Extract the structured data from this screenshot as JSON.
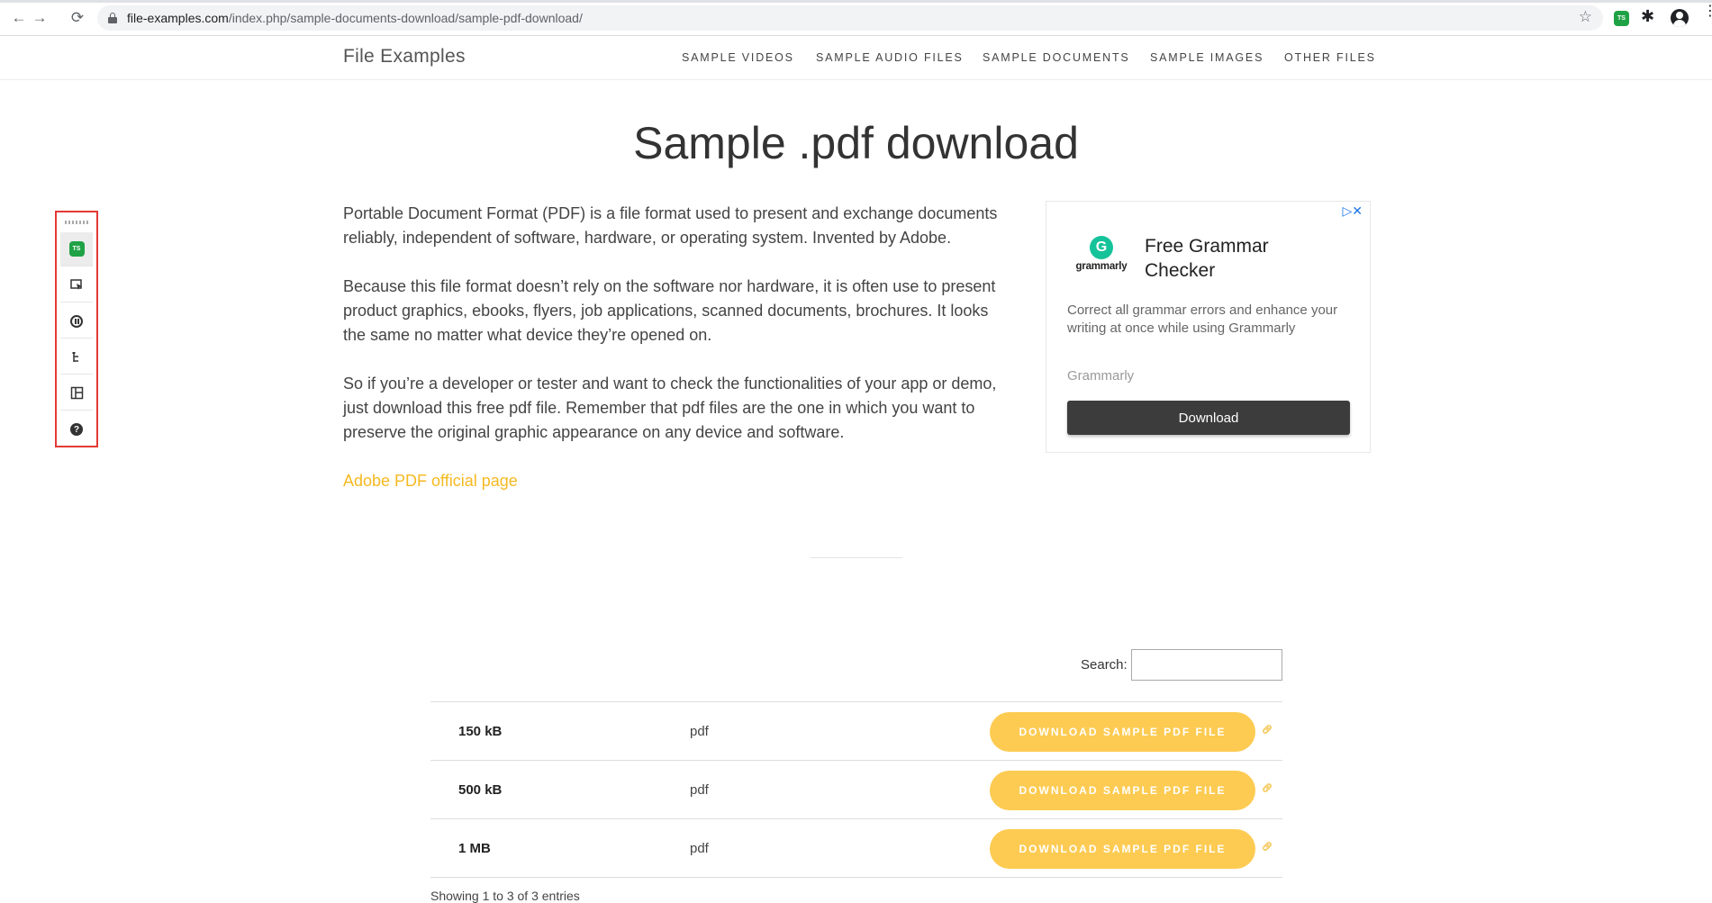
{
  "browser": {
    "url_domain": "file-examples.com",
    "url_path": "/index.php/sample-documents-download/sample-pdf-download/",
    "back_icon": "←",
    "forward_icon": "→",
    "reload_icon": "⟳",
    "star_icon": "☆",
    "puzzle_icon": "✱",
    "menu_icon": "⋮",
    "ext_badge": "TS"
  },
  "site": {
    "brand": "File Examples",
    "nav": [
      {
        "label": "SAMPLE VIDEOS"
      },
      {
        "label": "SAMPLE AUDIO FILES"
      },
      {
        "label": "SAMPLE DOCUMENTS"
      },
      {
        "label": "SAMPLE IMAGES"
      },
      {
        "label": "OTHER FILES"
      }
    ]
  },
  "main": {
    "title": "Sample .pdf download",
    "paragraphs": [
      "Portable Document Format (PDF) is a file format used to present and exchange documents reliably, independent of software, hardware, or operating system. Invented by Adobe.",
      "Because this file format doesn’t rely on the software nor hardware, it is often use to present product graphics, ebooks, flyers, job applications, scanned documents, brochures. It looks the same no matter what device they’re opened on.",
      "So if you’re a developer or tester and want to check the functionalities of your app or demo, just download this free pdf file. Remember that pdf files are the one in which you want to preserve the original graphic appearance on any device and software."
    ],
    "official_link": "Adobe PDF official page"
  },
  "ad": {
    "adchoices": "▷✕",
    "logo_letter": "G",
    "logo_word": "grammarly",
    "title": "Free Grammar Checker",
    "description": "Correct all grammar errors and enhance your writing at once while using Grammarly",
    "brand": "Grammarly",
    "button": "Download"
  },
  "table": {
    "search_label": "Search:",
    "search_value": "",
    "rows": [
      {
        "size": "150 kB",
        "type": "pdf",
        "button": "DOWNLOAD SAMPLE PDF FILE"
      },
      {
        "size": "500 kB",
        "type": "pdf",
        "button": "DOWNLOAD SAMPLE PDF FILE"
      },
      {
        "size": "1 MB",
        "type": "pdf",
        "button": "DOWNLOAD SAMPLE PDF FILE"
      }
    ],
    "info": "Showing 1 to 3 of 3 entries"
  },
  "toolbar": {
    "badge": "TS",
    "help": "?"
  },
  "colors": {
    "accent": "#fdcb52",
    "link": "#f5b921",
    "ad_button": "#3c3c3c",
    "toolbar_border": "#e53935",
    "grammarly_green": "#15c39a",
    "extension_green": "#1fa245"
  }
}
